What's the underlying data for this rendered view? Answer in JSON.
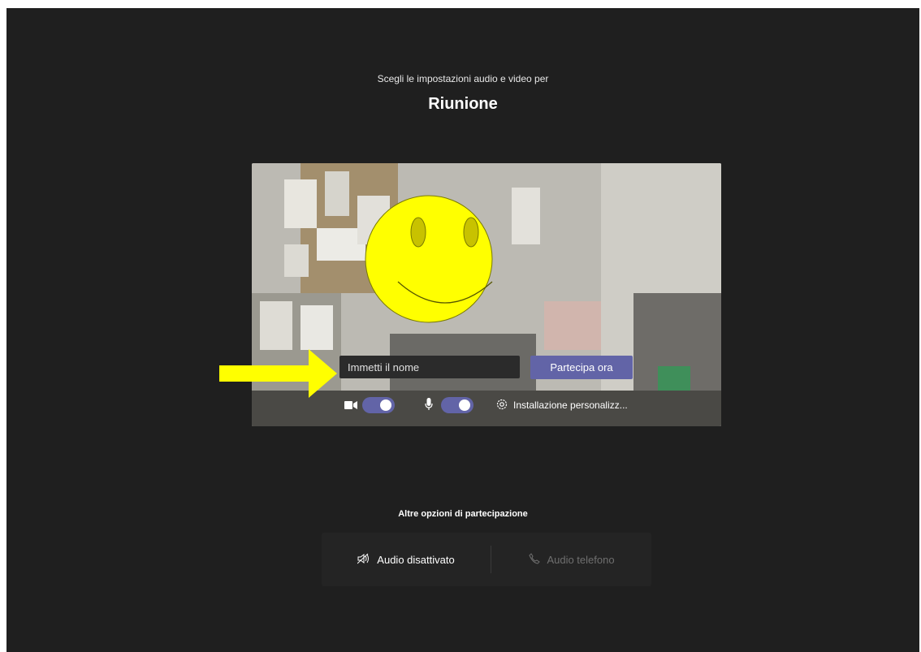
{
  "header": {
    "subtitle": "Scegli le impostazioni audio e video per",
    "meeting_title": "Riunione"
  },
  "prejoin": {
    "name_placeholder": "Immetti il nome",
    "name_value": "",
    "join_label": "Partecipa ora",
    "camera_toggle_on": true,
    "mic_toggle_on": true,
    "settings_label": "Installazione personalizz..."
  },
  "other_options": {
    "title": "Altre opzioni di partecipazione",
    "audio_off_label": "Audio disattivato",
    "phone_audio_label": "Audio telefono"
  },
  "colors": {
    "background": "#1f1f1f",
    "accent": "#6264a7",
    "annotation_arrow": "#ffff00",
    "smiley": "#ffff00"
  },
  "icons": {
    "camera": "video-camera-icon",
    "mic": "microphone-icon",
    "settings": "gear-icon",
    "audio_off": "speaker-muted-icon",
    "phone": "phone-icon"
  }
}
